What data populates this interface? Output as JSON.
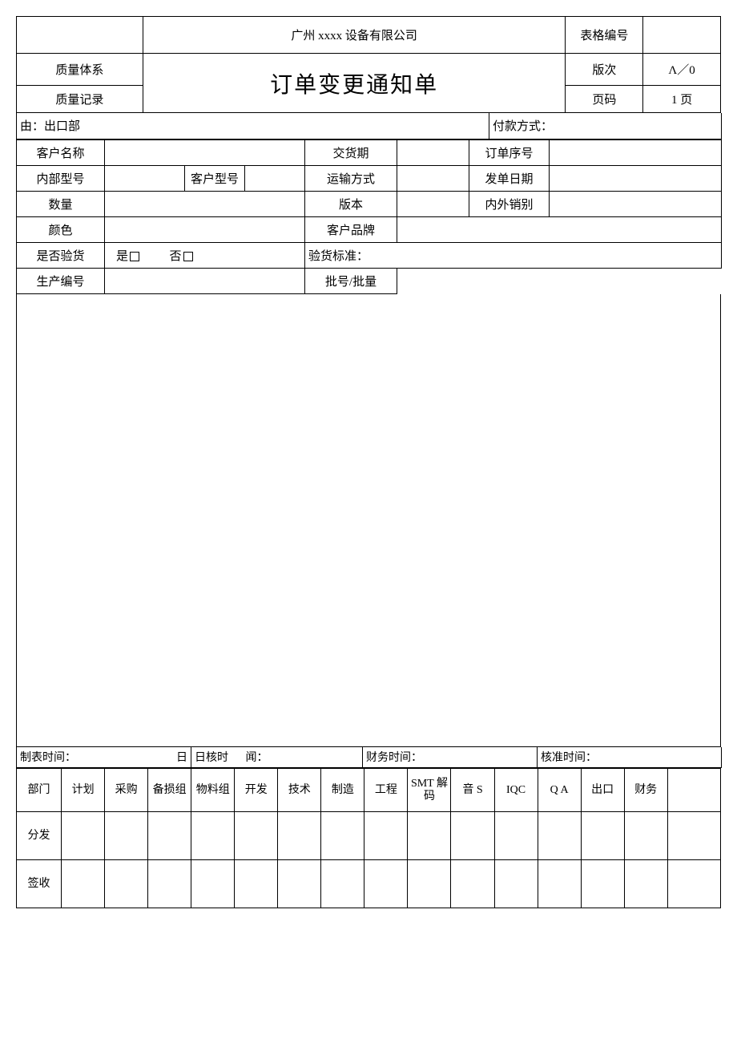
{
  "header": {
    "company": "广州 xxxx 设备有限公司",
    "form_code_label": "表格编号",
    "quality_system": "质量体系",
    "version_label": "版次",
    "version_value": "Λ／0",
    "title": "订单变更通知单",
    "quality_record": "质量记录",
    "page_label": "页码",
    "page_value": "1 页"
  },
  "meta": {
    "from": "由：出口部",
    "payment": "付款方式："
  },
  "rows": {
    "r1": {
      "a": "客户名称",
      "c": "交货期",
      "e": "订单序号"
    },
    "r2": {
      "a": "内部型号",
      "b": "客户型号",
      "c": "运输方式",
      "e": "发单日期"
    },
    "r3": {
      "a": "数量",
      "c": "版本",
      "e": "内外销别"
    },
    "r4": {
      "a": "颜色",
      "c": "客户品牌"
    },
    "r5": {
      "a": "是否验货",
      "yes": "是",
      "no": "否",
      "c": "验货标准："
    },
    "r6": {
      "a": "生产编号",
      "c": "批号/批量"
    }
  },
  "times": {
    "t1": "制表时间：",
    "t1b": "日",
    "t2": "日核时",
    "t2b": "闻：",
    "t3": "财务时间：",
    "t4": "核准时间："
  },
  "dist": {
    "dept": "部门",
    "cols": [
      "计划",
      "采购",
      "备损组",
      "物料组",
      "开发",
      "技术",
      "制造",
      "工程",
      "SMT 解码",
      "音 S",
      "IQC",
      "Q A",
      "出口",
      "财务"
    ],
    "rows": [
      "分发",
      "签收"
    ]
  }
}
